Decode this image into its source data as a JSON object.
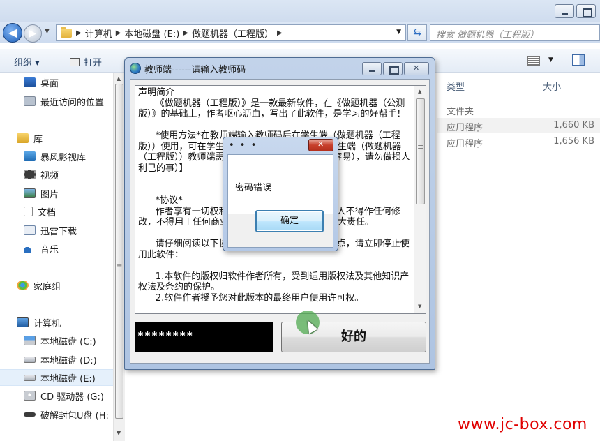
{
  "explorer": {
    "address": {
      "crumbs": [
        "计算机",
        "本地磁盘 (E:)",
        "做题机器（工程版）"
      ],
      "search_placeholder": "搜索 做题机器（工程版）"
    },
    "toolbar": {
      "organize": "组织 ▾",
      "open": "打开"
    },
    "sidebar": {
      "items": [
        {
          "label": "桌面"
        },
        {
          "label": "最近访问的位置"
        },
        {
          "label": "库"
        },
        {
          "label": "暴风影视库"
        },
        {
          "label": "视频"
        },
        {
          "label": "图片"
        },
        {
          "label": "文档"
        },
        {
          "label": "迅雷下载"
        },
        {
          "label": "音乐"
        },
        {
          "label": "家庭组"
        },
        {
          "label": "计算机"
        },
        {
          "label": "本地磁盘 (C:)"
        },
        {
          "label": "本地磁盘 (D:)"
        },
        {
          "label": "本地磁盘 (E:)"
        },
        {
          "label": "CD 驱动器 (G:)"
        },
        {
          "label": "破解封包U盘 (H:"
        }
      ]
    },
    "columns": {
      "type": "类型",
      "size": "大小"
    },
    "rows": [
      {
        "type": "文件夹",
        "size": ""
      },
      {
        "type": "应用程序",
        "size": "1,660 KB"
      },
      {
        "type": "应用程序",
        "size": "1,656 KB"
      }
    ],
    "watermark": "www.jc-box.com"
  },
  "dialog": {
    "title": "教师端------请输入教师码",
    "text": "声明简介\n      《做题机器（工程版）》是一款最新软件，在《做题机器（公测版）》的基础上，作者呕心沥血，写出了此软件，是学习的好帮手！\n\n      *使用方法*在教师端输入教师码后在学生端（做题机器（工程版））使用，可在学生端成为学生的复习助手。【学生端（做题机器（工程版））教师端需要教师码（要购买，破解很容易），请勿做损人利己的事）】\n\n\n      *协议*\n      作者享有一切权利，未经作者书面认可，任何人不得作任何修改，不得用于任何商业用途。违者作者将追究其最大责任。\n\n      请仔细阅读以下协议，如您不同意以下任何一点，请立即停止使用此软件：\n\n      1.本软件的版权归软件作者所有，受到适用版权法及其他知识产权法及条约的保护。\n      2.软件作者授予您对此版本的最终用户使用许可权。",
    "password_value": "********",
    "ok_label": "好的"
  },
  "msgbox": {
    "title": "• • •",
    "message": "密码错误",
    "ok_label": "确定"
  },
  "colors": {
    "accent": "#3c7fb1",
    "watermark": "#e00000",
    "close_red": "#c7402c"
  }
}
